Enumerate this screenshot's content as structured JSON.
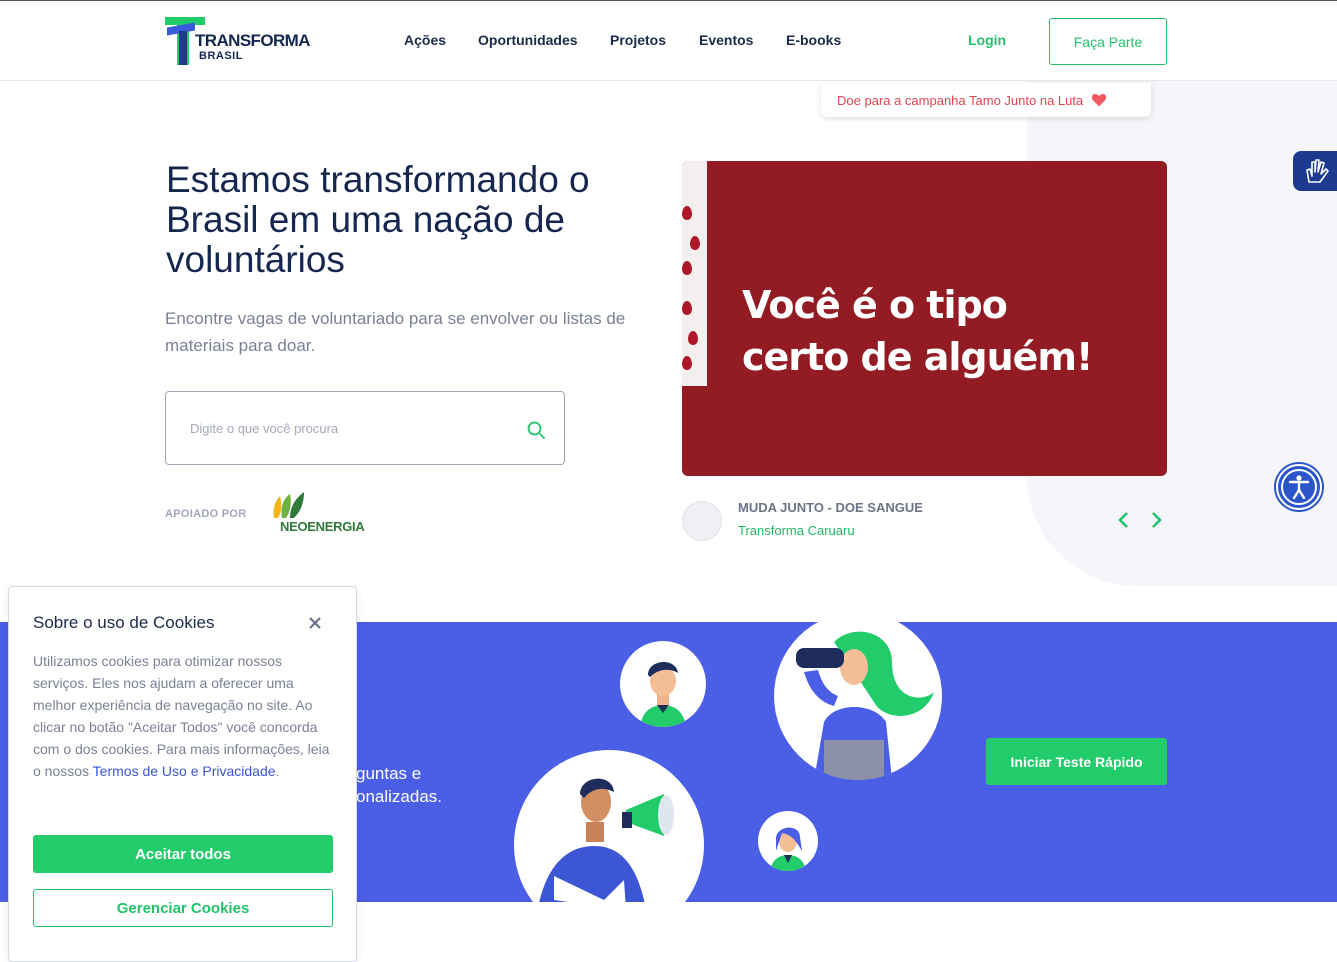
{
  "header": {
    "logo_text": "TRANSFORMA",
    "logo_sub": "BRASIL",
    "nav": [
      "Ações",
      "Oportunidades",
      "Projetos",
      "Eventos",
      "E-books"
    ],
    "login_label": "Login",
    "cta_label": "Faça Parte"
  },
  "donate": {
    "label": "Doe para a campanha Tamo Junto na Luta",
    "icon": "heart-icon"
  },
  "hero": {
    "title": "Estamos transformando o Brasil em uma nação de voluntários",
    "subtitle": "Encontre vagas de voluntariado para se envolver ou listas de materiais para doar.",
    "search_placeholder": "Digite o que você procura",
    "supported_by": "APOIADO POR",
    "sponsor": "NEOENERGIA"
  },
  "banner": {
    "line1": "Você é o tipo",
    "line2": "certo de alguém!",
    "card_title": "MUDA JUNTO - DOE SANGUE",
    "card_org": "Transforma Caruaru"
  },
  "band": {
    "text_line1": "guntas e",
    "text_line2": "onalizadas.",
    "cta_label": "Iniciar Teste Rápido"
  },
  "cookie": {
    "title": "Sobre o uso de Cookies",
    "body": "Utilizamos cookies para otimizar nossos serviços. Eles nos ajudam a oferecer uma melhor experiência de navegação no site. Ao clicar no botão \"Aceitar Todos\" você concorda com o dos cookies. Para mais informações, leia o nossos ",
    "link": "Termos de Uso e Privacidade",
    "body_end": ".",
    "accept_label": "Aceitar todos",
    "manage_label": "Gerenciar Cookies"
  },
  "colors": {
    "brand_green": "#22cc6a",
    "brand_navy": "#16274f",
    "band_blue": "#4a5fe5",
    "banner_red": "#931b23"
  }
}
